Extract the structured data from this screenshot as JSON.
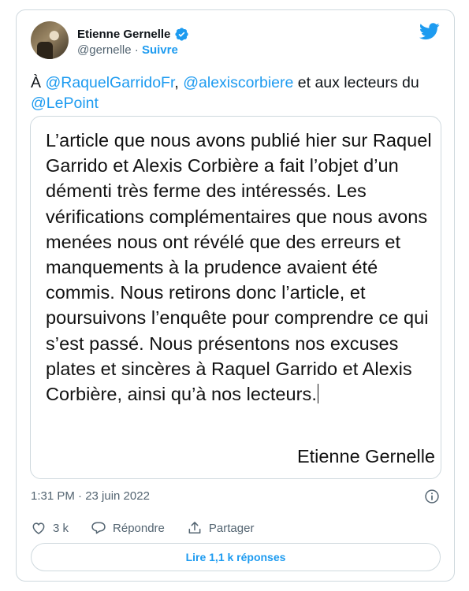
{
  "author": {
    "name": "Etienne Gernelle",
    "handle": "@gernelle",
    "separator": "·",
    "follow_label": "Suivre"
  },
  "tweet": {
    "prefix": "À ",
    "mention1": "@RaquelGarridoFr",
    "sep": ", ",
    "mention2": "@alexiscorbiere",
    "middle": " et aux lecteurs du ",
    "mention3": "@LePoint"
  },
  "media": {
    "text": "L’article que nous avons publié hier sur Raquel Garrido et Alexis Corbière a fait l’objet d’un démenti très ferme des intéressés. Les vérifications complémentaires que nous avons menées nous ont révélé que des erreurs et manquements à la prudence avaient été commis. Nous retirons donc l’article, et poursuivons l’enquête pour comprendre ce qui s’est passé. Nous présentons nos excuses plates et sincères à Raquel Garrido et Alexis Corbière, ainsi qu’à nos lecteurs.",
    "signature": "Etienne Gernelle"
  },
  "timestamp": "1:31 PM · 23 juin 2022",
  "actions": {
    "likes": "3 k",
    "reply_label": "Répondre",
    "share_label": "Partager"
  },
  "replies_button": "Lire 1,1 k réponses",
  "icons": {
    "verified": "verified-badge-icon",
    "brand": "twitter-bird-icon",
    "info": "info-icon",
    "like": "heart-icon",
    "reply": "reply-bubble-icon",
    "share": "share-icon"
  },
  "colors": {
    "accent": "#1d9bf0",
    "text": "#0f1419",
    "muted": "#536471",
    "border": "#cfd9de"
  }
}
